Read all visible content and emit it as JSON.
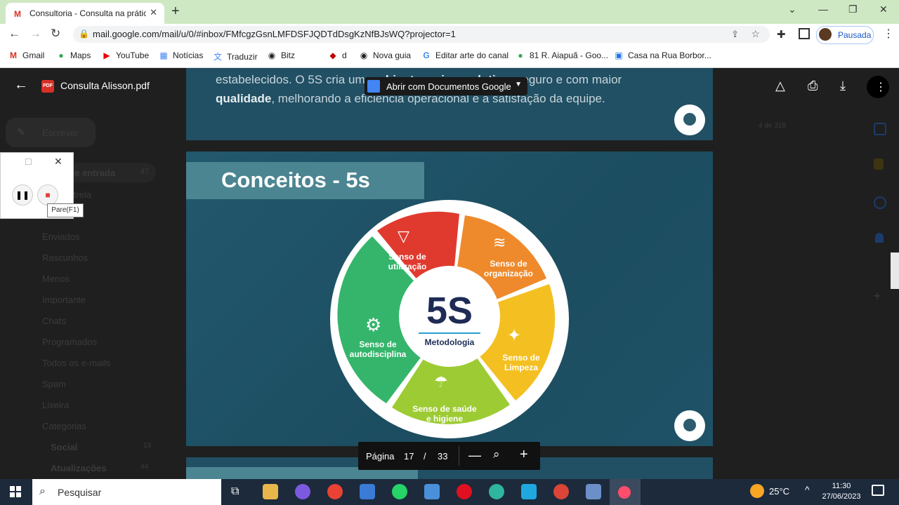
{
  "browser": {
    "tab_title": "Consultoria - Consulta na prática",
    "url": "mail.google.com/mail/u/0/#inbox/FMfcgzGsnLMFDSFJQDTdDsgKzNfBJsWQ?projector=1",
    "profile_status": "Pausada",
    "bookmarks": [
      "Gmail",
      "Maps",
      "YouTube",
      "Notícias",
      "Traduzir",
      "Bitz",
      "d",
      "Nova guia",
      "Editar arte do canal",
      "81 R. Aiapuã - Goo...",
      "Casa na Rua Borbor..."
    ]
  },
  "gmail": {
    "compose": "Escrever",
    "inbox": "Caixa de entrada",
    "inbox_count": "47",
    "count_label": "4 de 318",
    "folders": [
      "Com estrela",
      "Enviados",
      "Rascunhos",
      "Menos",
      "Importante",
      "Chats",
      "Programados",
      "Todos os e-mails",
      "Spam",
      "Lixeira",
      "Categorias",
      "Social",
      "Atualizações"
    ],
    "social_count": "13",
    "updates_count": "44"
  },
  "viewer": {
    "file_name": "Consulta Alisson.pdf",
    "open_with": "Abrir com Documentos Google",
    "page_label": "Página",
    "current_page": "17",
    "separator": "/",
    "total_pages": "33"
  },
  "slide_prev": {
    "line1_pre": "estabelecidos. O 5S cria um ",
    "line1_bold": "ambiente mais produtivo",
    "line1_post": ", seguro e com maior",
    "line2_bold": "qualidade",
    "line2_post": ", melhorando a eficiência operacional e a satisfação da equipe."
  },
  "slide": {
    "title": "Conceitos - 5s",
    "center_title": "5S",
    "center_subtitle": "Metodologia",
    "segments": [
      {
        "label1": "Senso de",
        "label2": "utilização",
        "color": "#e03a2f"
      },
      {
        "label1": "Senso de",
        "label2": "organização",
        "color": "#ee8a2c"
      },
      {
        "label1": "Senso de",
        "label2": "Limpeza",
        "color": "#f4c021"
      },
      {
        "label1": "Senso de saúde",
        "label2": "e higiene",
        "color": "#9dcb34"
      },
      {
        "label1": "Senso de",
        "label2": "autodisciplina",
        "color": "#34b56b"
      }
    ]
  },
  "recorder": {
    "tooltip": "Pare(F1)"
  },
  "taskbar": {
    "search_placeholder": "Pesquisar",
    "temperature": "25°C",
    "time": "11:30",
    "date": "27/06/2023"
  }
}
